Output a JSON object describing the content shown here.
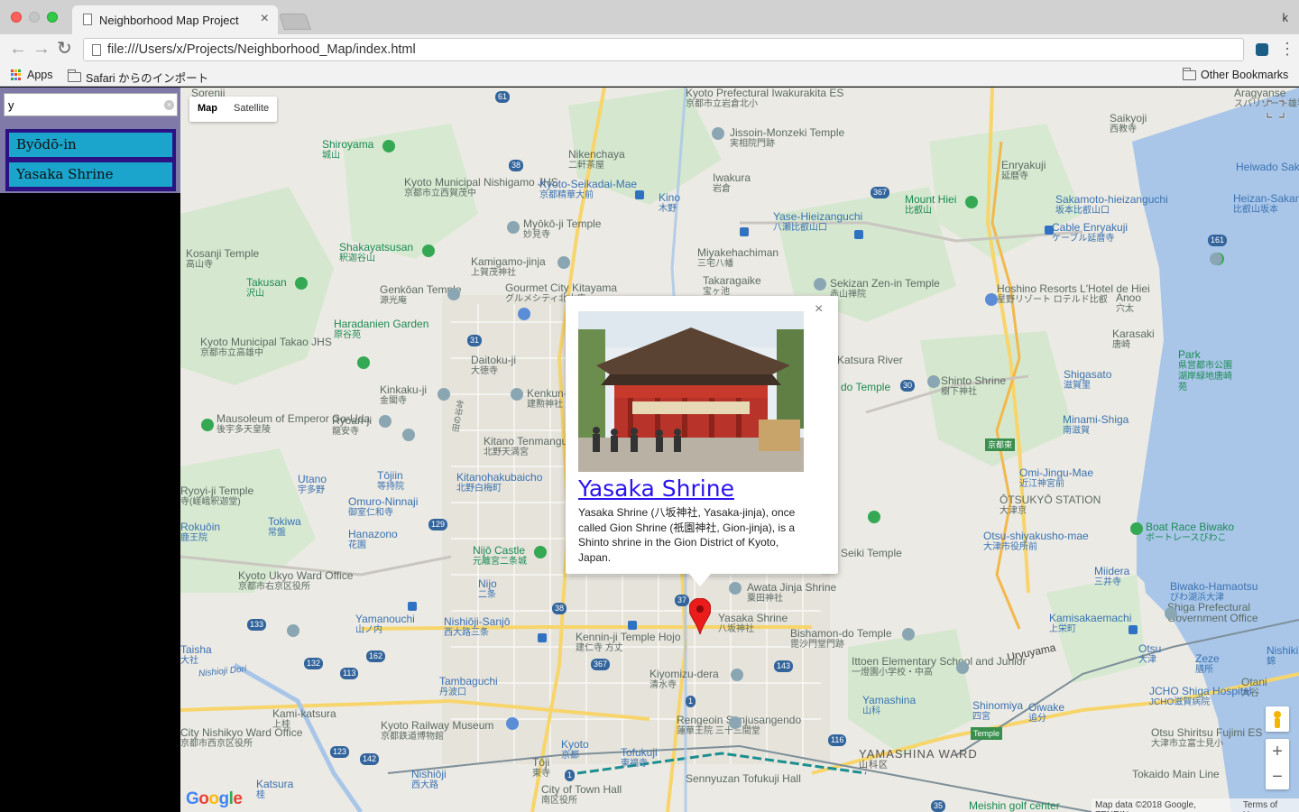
{
  "browser": {
    "tab_title": "Neighborhood Map Project",
    "profile_initial": "k",
    "url": "file:///Users/x/Projects/Neighborhood_Map/index.html",
    "bookmarks": {
      "apps": "Apps",
      "safari": "Safari からのインポート",
      "other": "Other Bookmarks"
    }
  },
  "sidebar": {
    "search_value": "y",
    "items": [
      {
        "label": "Byōdō-in"
      },
      {
        "label": "Yasaka Shrine"
      }
    ]
  },
  "map": {
    "type_controls": {
      "map": "Map",
      "satellite": "Satellite"
    },
    "zoom": {
      "in": "+",
      "out": "−"
    },
    "attribution": {
      "data": "Map data ©2018 Google, ZENRIN",
      "terms": "Terms of Use"
    },
    "logo": "Google",
    "labels": [
      {
        "t": "Sorenji"
      },
      {
        "t": "Shiroyama",
        "s": "城山"
      },
      {
        "t": "Kosanji Temple",
        "s": "高山寺"
      },
      {
        "t": "Takusan",
        "s": "沢山"
      },
      {
        "t": "Haradanien Garden",
        "s": "原谷苑"
      },
      {
        "t": "Kyoto Municipal Takao JHS",
        "s": "京都市立高雄中"
      },
      {
        "t": "Mausoleum of Emperor Go-Uda",
        "s": "後宇多天皇陵"
      },
      {
        "t": "Kyoto Municipal Nishigamo JHS",
        "s": "京都市立西賀茂中"
      },
      {
        "t": "Nikenchaya",
        "s": "二軒茶屋"
      },
      {
        "t": "Kyoto Prefectural Iwakurakita ES",
        "s": "京都市立岩倉北小"
      },
      {
        "t": "Jissoin-Monzeki Temple",
        "s": "実相院門跡"
      },
      {
        "t": "Kyoto-Seikadai-Mae",
        "s": "京都精華大前"
      },
      {
        "t": "Kino",
        "s": "木野"
      },
      {
        "t": "Iwakura",
        "s": "岩倉"
      },
      {
        "t": "Myōkō-ji Temple",
        "s": "妙見寺"
      },
      {
        "t": "Shakayatsusan",
        "s": "釈迦谷山"
      },
      {
        "t": "Kamigamo-jinja",
        "s": "上賀茂神社"
      },
      {
        "t": "Genkōan Temple",
        "s": "源光庵"
      },
      {
        "t": "Gourmet City Kitayama",
        "s": "グルメシティ北山店"
      },
      {
        "t": "Miyakehachiman",
        "s": "三宅八幡"
      },
      {
        "t": "Takaragaike",
        "s": "宝ヶ池"
      },
      {
        "t": "Yase-Hieizanguchi",
        "s": "八瀬比叡山口"
      },
      {
        "t": "Sekizan Zen-in Temple",
        "s": "赤山禅院"
      },
      {
        "t": "Mount Hiei",
        "s": "比叡山"
      },
      {
        "t": "Enryakuji",
        "s": "延暦寺"
      },
      {
        "t": "Saikyoji",
        "s": "西教寺"
      },
      {
        "t": "Sakamoto-hieizanguchi",
        "s": "坂本比叡山口"
      },
      {
        "t": "Cable Enryakuji",
        "s": "ケーブル延暦寺"
      },
      {
        "t": "Hoshino Resorts L'Hotel de Hiei",
        "s": "星野リゾート ロテルド比叡"
      },
      {
        "t": "Anoo",
        "s": "穴太"
      },
      {
        "t": "Karasaki",
        "s": "唐崎"
      },
      {
        "t": "Heiwado Sakamoto",
        "s": ""
      },
      {
        "t": "Heizan-Sakamoto",
        "s": "比叡山坂本"
      },
      {
        "t": "Aragyanse",
        "s": "スパリゾート雄琴 あかね"
      },
      {
        "t": "Park",
        "s": "県営都市公園湖岸緑地唐崎苑"
      },
      {
        "t": "Daitoku-ji",
        "s": "大徳寺"
      },
      {
        "t": "Kinkaku-ji",
        "s": "金閣寺"
      },
      {
        "t": "Kenkun-jinja",
        "s": "建勲神社"
      },
      {
        "t": "Ryōan-ji",
        "s": "龍安寺"
      },
      {
        "t": "Kitano Tenmangu",
        "s": "北野天満宮"
      },
      {
        "t": "Kitanohakubaicho",
        "s": "北野白梅町"
      },
      {
        "t": "Tōjiin",
        "s": "等持院"
      },
      {
        "t": "Utano",
        "s": "宇多野"
      },
      {
        "t": "Omuro-Ninnaji",
        "s": "御室仁和寺"
      },
      {
        "t": "Ryoyi-ji Temple",
        "s": "寺(嵯峨釈迦堂)"
      },
      {
        "t": "Rokuōin",
        "s": "鹿王院"
      },
      {
        "t": "Tokiwa",
        "s": "常盤"
      },
      {
        "t": "Hanazono",
        "s": "花園"
      },
      {
        "t": "Nijō Castle",
        "s": "元離宮二条城"
      },
      {
        "t": "Kyoto Ukyo Ward Office",
        "s": "京都市右京区役所"
      },
      {
        "t": "Nijo",
        "s": "二条"
      },
      {
        "t": "Yamanouchi",
        "s": "山ノ内"
      },
      {
        "t": "Nishiōji-Sanjō",
        "s": "西大路三条"
      },
      {
        "t": "Kennin-ji Temple Hojo",
        "s": "建仁寺 方丈"
      },
      {
        "t": "Tambaguchi",
        "s": "丹波口"
      },
      {
        "t": "Kiyomizu-dera",
        "s": "清水寺"
      },
      {
        "t": "Kyoto Railway Museum",
        "s": "京都鉄道博物館"
      },
      {
        "t": "Rengeoin Sanjusangendo",
        "s": "蓮華王院 三十三間堂"
      },
      {
        "t": "Kyoto",
        "s": "京都"
      },
      {
        "t": "Tofukuji",
        "s": "東福寺"
      },
      {
        "t": "Sennyuzan Tofukuji Hall",
        "s": ""
      },
      {
        "t": "City of Town Hall",
        "s": "南区役所"
      },
      {
        "t": "Nishiōji",
        "s": "西大路"
      },
      {
        "t": "Katsura",
        "s": "桂"
      },
      {
        "t": "Kami-katsura",
        "s": "上桂"
      },
      {
        "t": "City Nishikyo Ward Office",
        "s": "京都市西京区役所"
      },
      {
        "t": "Taisha",
        "s": "大社"
      },
      {
        "t": "Tōji",
        "s": "東寺"
      },
      {
        "t": "Awata Jinja Shrine",
        "s": "粟田神社"
      },
      {
        "t": "Yasaka Shrine",
        "s": "八坂神社"
      },
      {
        "t": "Bishamon-do Temple",
        "s": "毘沙門堂門跡"
      },
      {
        "t": "Ittoen Elementary School and Junior",
        "s": "一燈園小学校・中高"
      },
      {
        "t": "Yamashina",
        "s": "山科"
      },
      {
        "t": "Shinomiya",
        "s": "四宮"
      },
      {
        "t": "Oiwake",
        "s": "追分"
      },
      {
        "t": "YAMASHINA WARD",
        "s": "山科区"
      },
      {
        "t": "Meishin golf center",
        "s": ""
      },
      {
        "t": "Shinto Shrine",
        "s": "樹下神社"
      },
      {
        "t": "Shigasato",
        "s": "滋賀里"
      },
      {
        "t": "Minami-Shiga",
        "s": "南滋賀"
      },
      {
        "t": "Omi-Jingu-Mae",
        "s": "近江神宮前"
      },
      {
        "t": "ŌTSUKYŌ STATION",
        "s": "大津京"
      },
      {
        "t": "Otsu-shiyakusho-mae",
        "s": "大津市役所前"
      },
      {
        "t": "Boat Race Biwako",
        "s": "ボートレースびわこ"
      },
      {
        "t": "Miidera",
        "s": "三井寺"
      },
      {
        "t": "Biwako-Hamaotsu",
        "s": "びわ湖浜大津"
      },
      {
        "t": "Shiga Prefectural Government Office",
        "s": ""
      },
      {
        "t": "Kamisakaemachi",
        "s": "上栄町"
      },
      {
        "t": "Otsu",
        "s": "大津"
      },
      {
        "t": "Zeze",
        "s": "膳所"
      },
      {
        "t": "Nishiki",
        "s": "錦"
      },
      {
        "t": "Otani",
        "s": "大谷"
      },
      {
        "t": "JCHO Shiga Hospital",
        "s": "JCHO滋賀病院"
      },
      {
        "t": "Otsu Shiritsu Fujimi ES",
        "s": "大津市立富士見小"
      },
      {
        "t": "Tokaido Main Line"
      },
      {
        "t": "Uryuyama",
        "s": "瓜生山"
      },
      {
        "t": "do Temple"
      },
      {
        "t": "Katsura River"
      },
      {
        "t": "Nishioji Dori"
      },
      {
        "t": "田の谷峠"
      },
      {
        "t": "京都東"
      },
      {
        "t": "Temple",
        "s": "(毘沙門堂)"
      },
      {
        "t": "Seiki Temple",
        "s": ""
      }
    ],
    "shields": [
      "61",
      "38",
      "367",
      "31",
      "129",
      "38",
      "37",
      "132",
      "162",
      "113",
      "133",
      "143",
      "367",
      "1",
      "116",
      "123",
      "142",
      "30",
      "161",
      "35",
      "1",
      "24",
      "9",
      "1",
      "1"
    ],
    "info_window": {
      "title": "Yasaka Shrine",
      "description": "Yasaka Shrine (八坂神社, Yasaka-jinja), once called Gion Shrine (祇園神社, Gion-jinja), is a Shinto shrine in the Gion District of Kyoto, Japan."
    },
    "colors": {
      "sidebar_list_bg": "#2b1282",
      "list_item_bg": "#1ba4cc",
      "search_panel_bg": "#7f7aa8",
      "link": "#2a13ee",
      "marker": "#ea1c1c"
    }
  }
}
